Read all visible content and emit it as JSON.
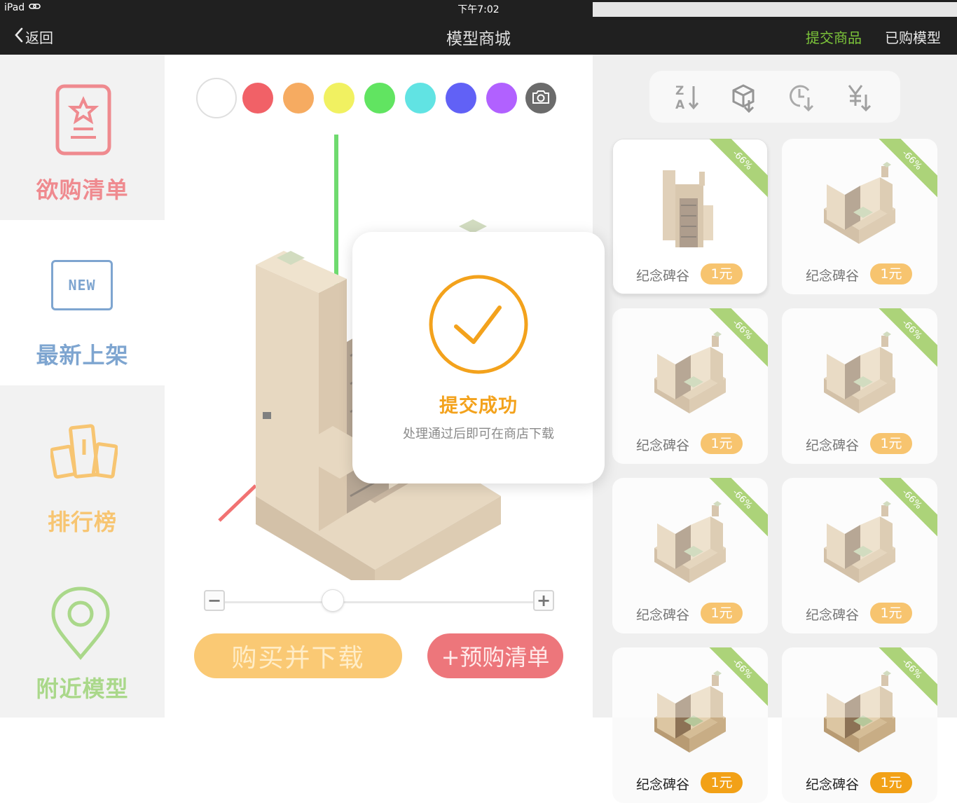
{
  "statusbar": {
    "device": "iPad",
    "time": "下午7:02"
  },
  "navbar": {
    "back": "返回",
    "title": "模型商城",
    "submit": "提交商品",
    "bought": "已购模型"
  },
  "sidebar": {
    "items": [
      {
        "label": "欲购清单",
        "icon": "wishlist-icon",
        "color": "#e5434b"
      },
      {
        "label": "最新上架",
        "icon": "new-badge-icon",
        "badge": "NEW",
        "color": "#2f6fb3",
        "active": true
      },
      {
        "label": "排行榜",
        "icon": "ranking-icon",
        "color": "#f3a21c"
      },
      {
        "label": "附近模型",
        "icon": "location-pin-icon",
        "color": "#76c043"
      }
    ]
  },
  "palette": {
    "colors": [
      "#ffffff",
      "#e8000a",
      "#f07800",
      "#e8e800",
      "#00d400",
      "#00d2d2",
      "#0000f0",
      "#8200ff"
    ],
    "camera_icon": "camera-icon"
  },
  "viewer": {
    "axis_colors": {
      "y": "#18c418",
      "x": "#e81c1c"
    }
  },
  "actions": {
    "buy_download": "购买并下载",
    "prebuy_list": "+预购清单"
  },
  "sortbar": {
    "buttons": [
      "sort-az-icon",
      "sort-model-icon",
      "sort-time-icon",
      "sort-price-icon"
    ]
  },
  "products": [
    {
      "name": "纪念碑谷",
      "price": "1元",
      "discount": "-66%",
      "selected": true
    },
    {
      "name": "纪念碑谷",
      "price": "1元",
      "discount": "-66%"
    },
    {
      "name": "纪念碑谷",
      "price": "1元",
      "discount": "-66%"
    },
    {
      "name": "纪念碑谷",
      "price": "1元",
      "discount": "-66%"
    },
    {
      "name": "纪念碑谷",
      "price": "1元",
      "discount": "-66%"
    },
    {
      "name": "纪念碑谷",
      "price": "1元",
      "discount": "-66%"
    },
    {
      "name": "纪念碑谷",
      "price": "1元",
      "discount": "-66%"
    },
    {
      "name": "纪念碑谷",
      "price": "1元",
      "discount": "-66%"
    }
  ],
  "dialog": {
    "title": "提交成功",
    "message": "处理通过后即可在商店下载",
    "icon": "success-check-icon",
    "accent": "#f3a21c"
  }
}
